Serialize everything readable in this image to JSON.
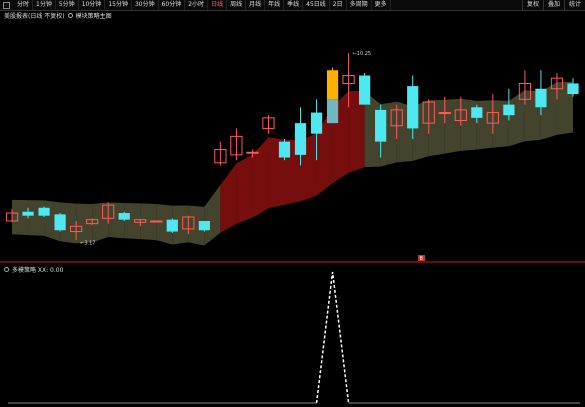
{
  "toolbar": {
    "tabs": [
      {
        "label": "分时"
      },
      {
        "label": "1分钟"
      },
      {
        "label": "5分钟"
      },
      {
        "label": "10分钟"
      },
      {
        "label": "15分钟"
      },
      {
        "label": "30分钟"
      },
      {
        "label": "60分钟"
      },
      {
        "label": "2小时"
      },
      {
        "label": "日线"
      },
      {
        "label": "周线"
      },
      {
        "label": "月线"
      },
      {
        "label": "年线"
      },
      {
        "label": "季线"
      },
      {
        "label": "45日线"
      },
      {
        "label": "2日"
      },
      {
        "label": "多周期"
      },
      {
        "label": "更多"
      }
    ],
    "active_tab": "日线",
    "right_buttons": [
      {
        "label": "复权"
      },
      {
        "label": "叠加"
      },
      {
        "label": "统计"
      }
    ]
  },
  "main_chart": {
    "title": "美股报表(日线 不复权)",
    "indicator_label": "模块策略主图",
    "high_label": "10.25",
    "low_label": "3.17",
    "marker_label": "B"
  },
  "sub_chart": {
    "title": "多模策略 XX: 0.00"
  },
  "colors": {
    "up": "#ff5a5a",
    "down": "#4de8f0",
    "highlight": "#ffb000",
    "cloud_olive": "#4b4a32",
    "cloud_red": "#8b1010",
    "signal_line": "#ffffff"
  },
  "chart_data": {
    "type": "candlestick",
    "candles": [
      {
        "open": 3.9,
        "close": 4.2,
        "high": 4.35,
        "low": 3.85
      },
      {
        "open": 4.25,
        "close": 4.1,
        "high": 4.4,
        "low": 4.0
      },
      {
        "open": 4.4,
        "close": 4.1,
        "high": 4.45,
        "low": 4.05
      },
      {
        "open": 4.15,
        "close": 3.55,
        "high": 4.2,
        "low": 3.5
      },
      {
        "open": 3.5,
        "close": 3.7,
        "high": 3.9,
        "low": 3.17
      },
      {
        "open": 3.8,
        "close": 3.95,
        "high": 4.0,
        "low": 3.75
      },
      {
        "open": 4.0,
        "close": 4.5,
        "high": 4.6,
        "low": 3.8
      },
      {
        "open": 4.2,
        "close": 3.95,
        "high": 4.25,
        "low": 3.9
      },
      {
        "open": 3.85,
        "close": 3.95,
        "high": 3.98,
        "low": 3.7
      },
      {
        "open": 3.9,
        "close": 3.9,
        "high": 3.92,
        "low": 3.88
      },
      {
        "open": 3.95,
        "close": 3.5,
        "high": 4.0,
        "low": 3.45
      },
      {
        "open": 3.6,
        "close": 4.05,
        "high": 4.1,
        "low": 3.4
      },
      {
        "open": 3.9,
        "close": 3.55,
        "high": 3.9,
        "low": 3.5
      },
      {
        "open": 6.1,
        "close": 6.6,
        "high": 6.9,
        "low": 6.0
      },
      {
        "open": 6.4,
        "close": 7.1,
        "high": 7.4,
        "low": 6.2
      },
      {
        "open": 6.5,
        "close": 6.5,
        "high": 6.6,
        "low": 6.3
      },
      {
        "open": 7.4,
        "close": 7.8,
        "high": 7.9,
        "low": 7.2
      },
      {
        "open": 6.9,
        "close": 6.3,
        "high": 7.0,
        "low": 6.2
      },
      {
        "open": 7.6,
        "close": 6.4,
        "high": 8.2,
        "low": 6.0
      },
      {
        "open": 8.0,
        "close": 7.2,
        "high": 8.5,
        "low": 6.2
      },
      {
        "open": 7.6,
        "close": 9.6,
        "high": 9.7,
        "low": 7.6
      },
      {
        "open": 9.1,
        "close": 9.4,
        "high": 10.25,
        "low": 8.2
      },
      {
        "open": 9.4,
        "close": 8.3,
        "high": 9.5,
        "low": 8.3
      },
      {
        "open": 8.1,
        "close": 6.9,
        "high": 8.3,
        "low": 6.3
      },
      {
        "open": 7.5,
        "close": 8.1,
        "high": 8.3,
        "low": 7.0
      },
      {
        "open": 9.0,
        "close": 7.4,
        "high": 9.4,
        "low": 7.0
      },
      {
        "open": 7.6,
        "close": 8.4,
        "high": 8.5,
        "low": 7.2
      },
      {
        "open": 8.0,
        "close": 8.0,
        "high": 8.6,
        "low": 7.6
      },
      {
        "open": 7.7,
        "close": 8.1,
        "high": 8.6,
        "low": 7.5
      },
      {
        "open": 8.2,
        "close": 7.8,
        "high": 8.3,
        "low": 7.6
      },
      {
        "open": 7.6,
        "close": 8.0,
        "high": 8.7,
        "low": 7.2
      },
      {
        "open": 8.3,
        "close": 7.9,
        "high": 8.9,
        "low": 7.7
      },
      {
        "open": 8.5,
        "close": 9.1,
        "high": 9.6,
        "low": 8.3
      },
      {
        "open": 8.9,
        "close": 8.2,
        "high": 9.6,
        "low": 7.9
      },
      {
        "open": 8.9,
        "close": 9.3,
        "high": 9.5,
        "low": 8.5
      },
      {
        "open": 9.1,
        "close": 8.7,
        "high": 9.3,
        "low": 8.6
      }
    ],
    "highlighted_candle": 20,
    "signal": {
      "peak_index": 20,
      "baseline": 0,
      "peak": 1
    }
  }
}
